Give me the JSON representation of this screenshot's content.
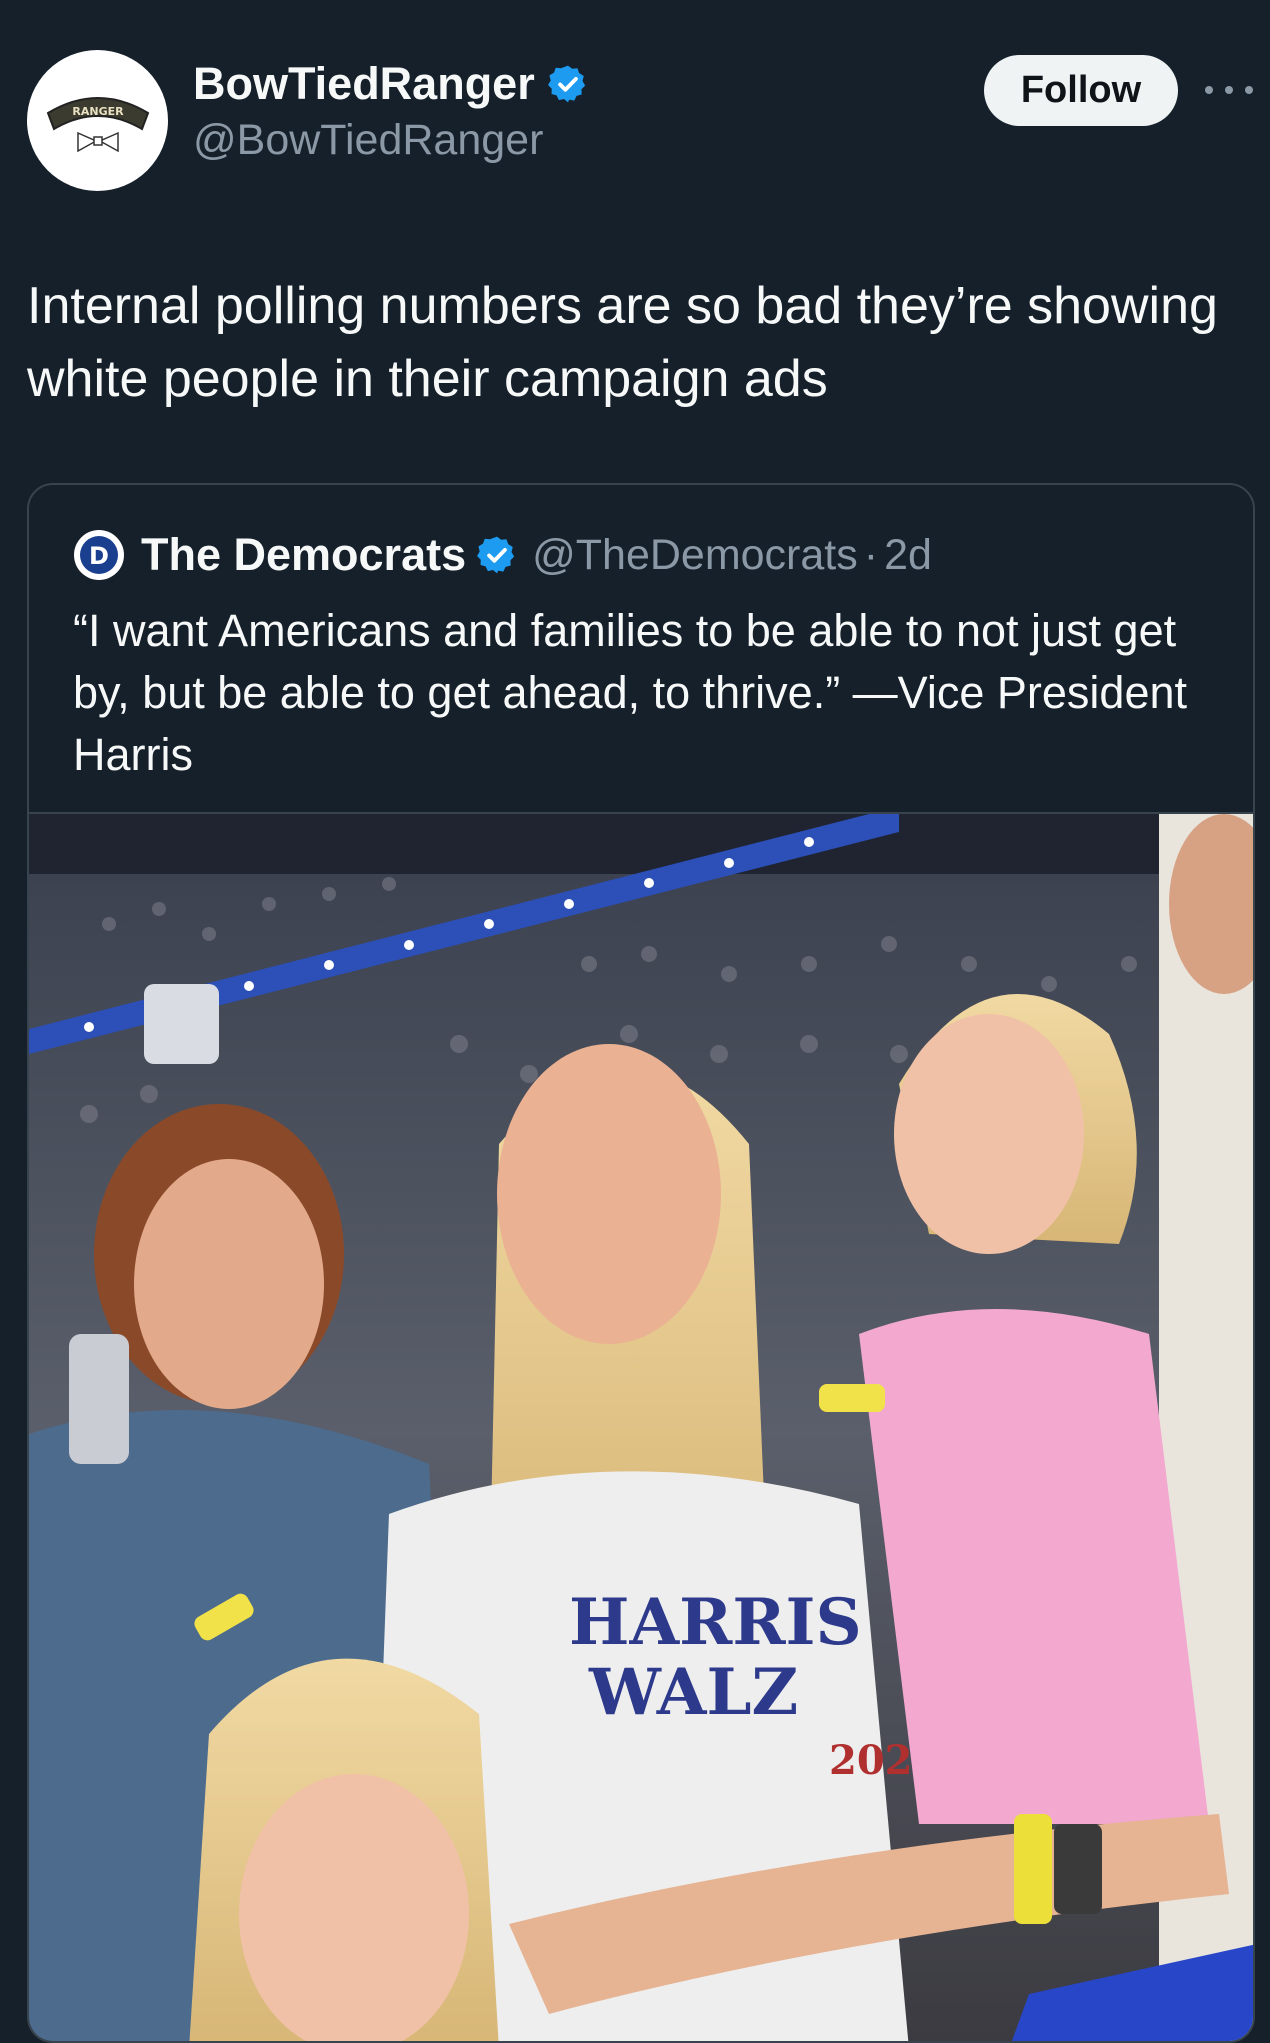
{
  "author": {
    "name": "BowTiedRanger",
    "handle": "@BowTiedRanger",
    "avatar_label": "RANGER",
    "verified": true
  },
  "actions": {
    "follow_label": "Follow"
  },
  "tweet": {
    "text": "Internal polling numbers are so bad they’re showing white people in their campaign ads"
  },
  "quoted": {
    "name": "The Democrats",
    "handle": "@TheDemocrats",
    "separator": "·",
    "time": "2d",
    "logo_letter": "D",
    "text": "“I want Americans and families to be able to not just get by, but be able to get ahead, to thrive.” —Vice President Harris",
    "shirt_text": [
      "HARRIS",
      "WALZ",
      "202"
    ]
  },
  "colors": {
    "background": "#15202b",
    "verified_blue": "#1d9bf0",
    "secondary_text": "#8b98a5",
    "border": "#38444d"
  }
}
